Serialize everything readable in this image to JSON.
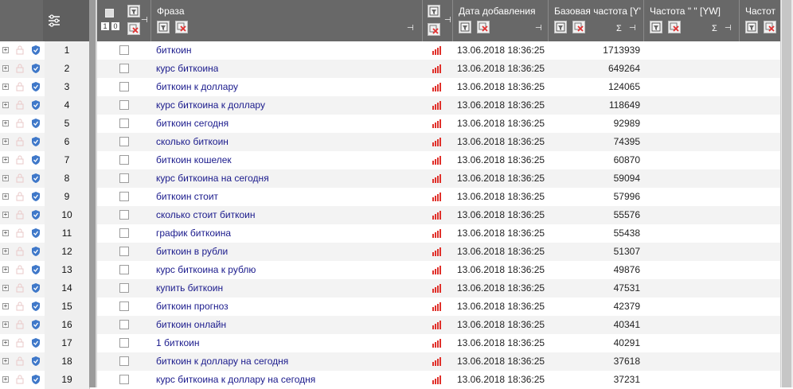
{
  "header": {
    "phrase_label": "Фраза",
    "date_label": "Дата добавления",
    "base_freq_label": "Базовая частота [Y'",
    "freq_label": "Частота \" \" [YW]",
    "freq2_label": "Частот",
    "sigma": "Σ",
    "pin": "⊣",
    "checkbox_one": "1",
    "checkbox_zero": "0"
  },
  "colors": {
    "header_bg": "#686868",
    "phrase_text": "#1a1a8c",
    "bars_icon": "#e0302a",
    "shield_icon": "#3f78c9"
  },
  "rows": [
    {
      "num": "1",
      "phrase": "биткоин",
      "date": "13.06.2018 18:36:25",
      "freq": "1713939"
    },
    {
      "num": "2",
      "phrase": "курс биткоина",
      "date": "13.06.2018 18:36:25",
      "freq": "649264"
    },
    {
      "num": "3",
      "phrase": "биткоин к доллару",
      "date": "13.06.2018 18:36:25",
      "freq": "124065"
    },
    {
      "num": "4",
      "phrase": "курс биткоина к доллару",
      "date": "13.06.2018 18:36:25",
      "freq": "118649"
    },
    {
      "num": "5",
      "phrase": "биткоин сегодня",
      "date": "13.06.2018 18:36:25",
      "freq": "92989"
    },
    {
      "num": "6",
      "phrase": "сколько биткоин",
      "date": "13.06.2018 18:36:25",
      "freq": "74395"
    },
    {
      "num": "7",
      "phrase": "биткоин кошелек",
      "date": "13.06.2018 18:36:25",
      "freq": "60870"
    },
    {
      "num": "8",
      "phrase": "курс биткоина на сегодня",
      "date": "13.06.2018 18:36:25",
      "freq": "59094"
    },
    {
      "num": "9",
      "phrase": "биткоин стоит",
      "date": "13.06.2018 18:36:25",
      "freq": "57996"
    },
    {
      "num": "10",
      "phrase": "сколько стоит биткоин",
      "date": "13.06.2018 18:36:25",
      "freq": "55576"
    },
    {
      "num": "11",
      "phrase": "график биткоина",
      "date": "13.06.2018 18:36:25",
      "freq": "55438"
    },
    {
      "num": "12",
      "phrase": "биткоин в рубли",
      "date": "13.06.2018 18:36:25",
      "freq": "51307"
    },
    {
      "num": "13",
      "phrase": "курс биткоина к рублю",
      "date": "13.06.2018 18:36:25",
      "freq": "49876"
    },
    {
      "num": "14",
      "phrase": "купить биткоин",
      "date": "13.06.2018 18:36:25",
      "freq": "47531"
    },
    {
      "num": "15",
      "phrase": "биткоин прогноз",
      "date": "13.06.2018 18:36:25",
      "freq": "42379"
    },
    {
      "num": "16",
      "phrase": "биткоин онлайн",
      "date": "13.06.2018 18:36:25",
      "freq": "40341"
    },
    {
      "num": "17",
      "phrase": "1 биткоин",
      "date": "13.06.2018 18:36:25",
      "freq": "40291"
    },
    {
      "num": "18",
      "phrase": "биткоин к доллару на сегодня",
      "date": "13.06.2018 18:36:25",
      "freq": "37618"
    },
    {
      "num": "19",
      "phrase": "курс биткоина к доллару на сегодня",
      "date": "13.06.2018 18:36:25",
      "freq": "37231"
    }
  ]
}
